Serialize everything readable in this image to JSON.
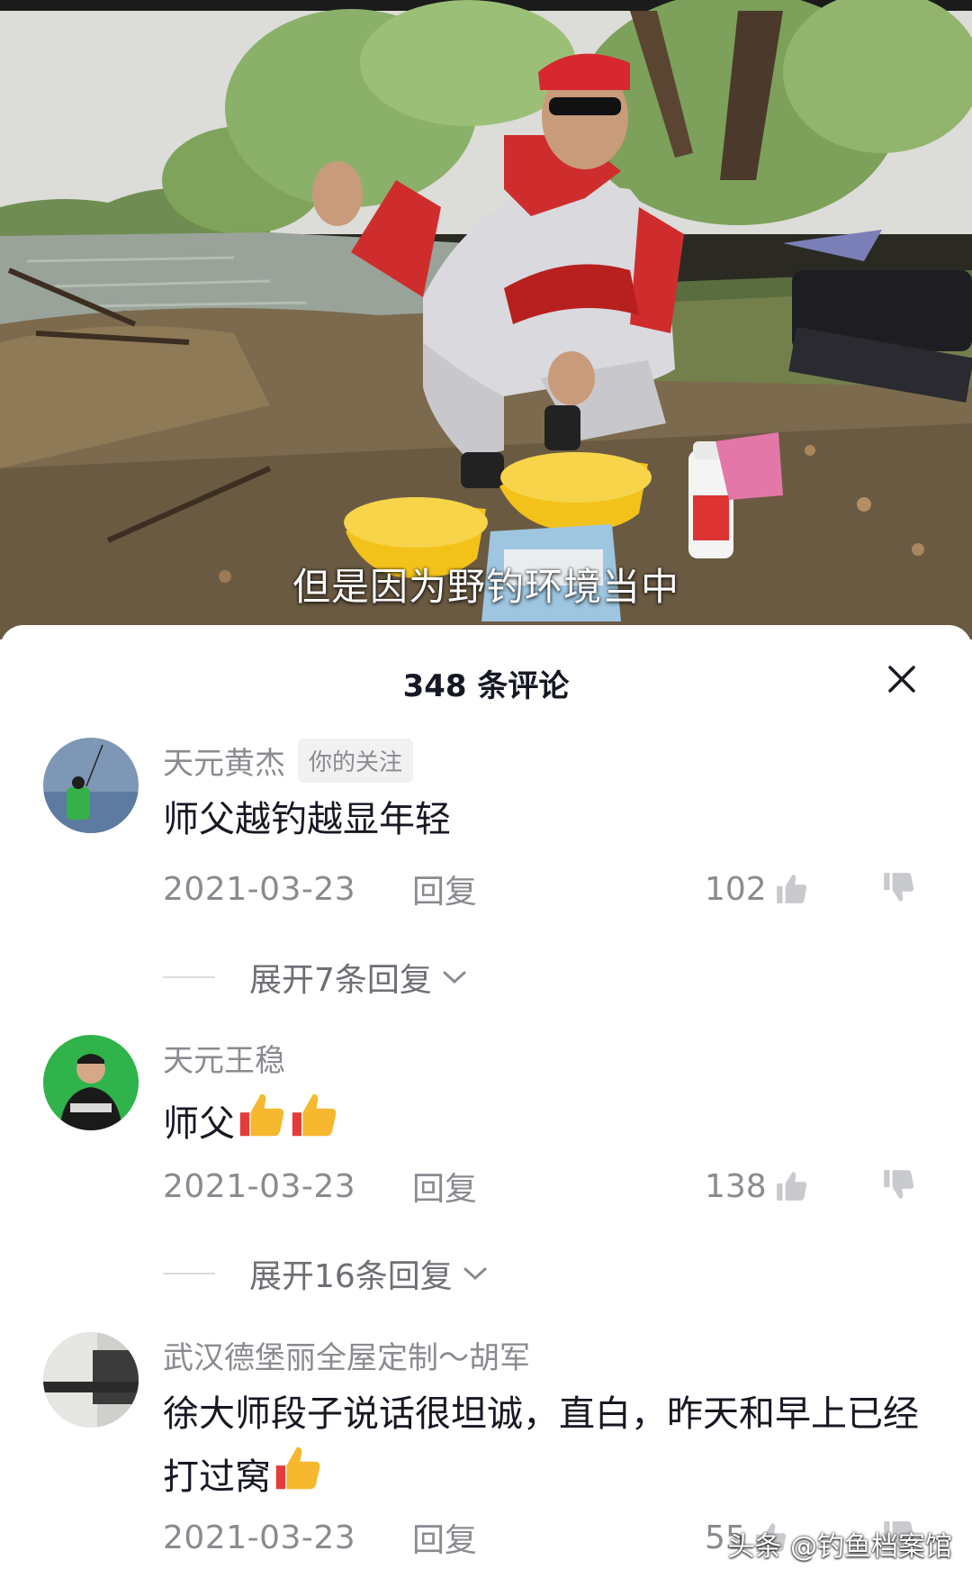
{
  "video": {
    "subtitle": "但是因为野钓环境当中"
  },
  "comments_panel": {
    "title": "348 条评论",
    "close_icon": "close-icon"
  },
  "comments": [
    {
      "username": "天元黄杰",
      "badge": "你的关注",
      "text": "师父越钓越显年轻",
      "date": "2021-03-23",
      "reply_label": "回复",
      "likes": "102",
      "expand_label": "展开7条回复"
    },
    {
      "username": "天元王稳",
      "text": "师父",
      "emoji": [
        "thumbs-up",
        "thumbs-up"
      ],
      "date": "2021-03-23",
      "reply_label": "回复",
      "likes": "138",
      "expand_label": "展开16条回复"
    },
    {
      "username": "武汉德堡丽全屋定制～胡军",
      "text": "徐大师段子说话很坦诚，直白，昨天和早上已经打过窝",
      "emoji": [
        "thumbs-up"
      ],
      "date": "2021-03-23",
      "reply_label": "回复",
      "likes": "55"
    }
  ],
  "watermark": "头条 @钓鱼档案馆",
  "colors": {
    "primary_text": "#161823",
    "secondary_text": "#8a8b91",
    "emoji_thumb": "#f5b82e"
  }
}
